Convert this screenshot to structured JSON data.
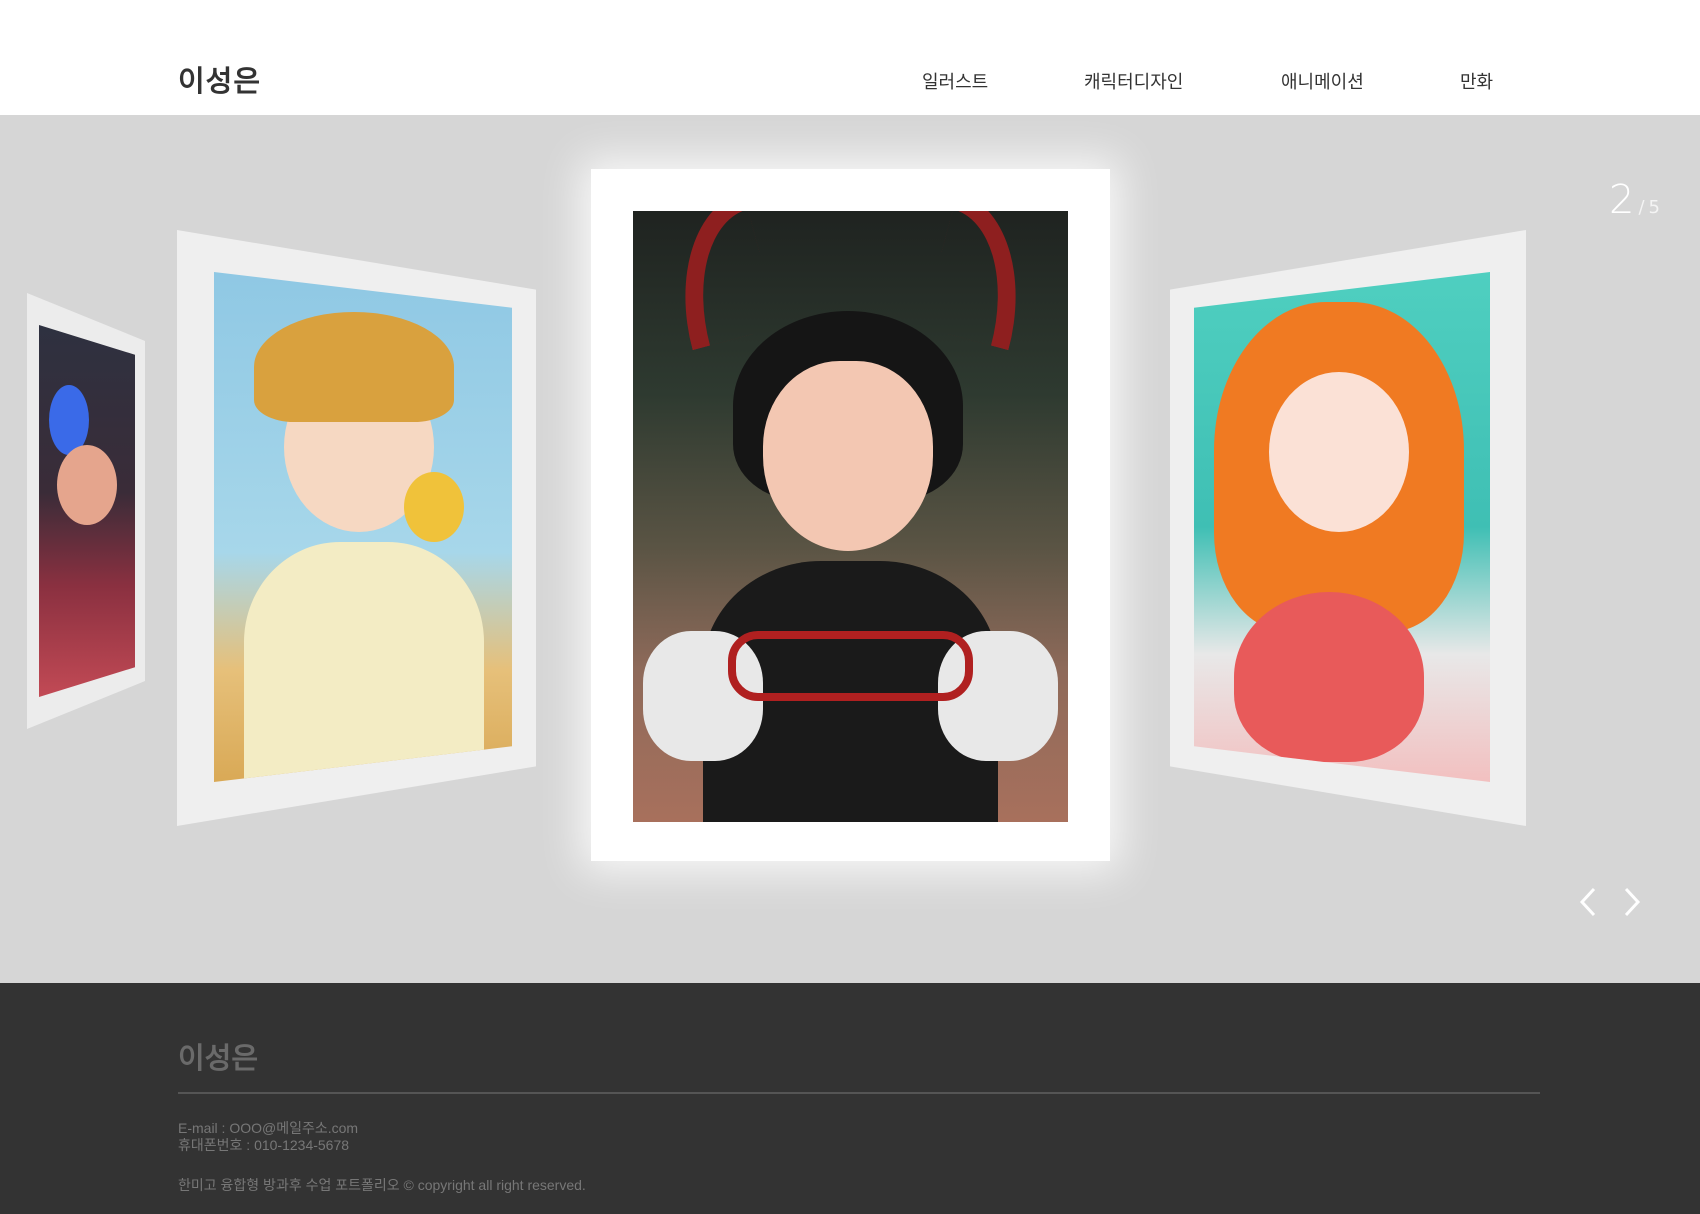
{
  "header": {
    "logo": "이성은",
    "nav": [
      "일러스트",
      "캐릭터디자인",
      "애니메이션",
      "만화"
    ]
  },
  "gallery": {
    "current": "2",
    "separator": "/",
    "total": "5"
  },
  "footer": {
    "logo": "이성은",
    "email": "E-mail : OOO@메일주소.com",
    "phone": "휴대폰번호 : 010-1234-5678",
    "copyright": "한미고 융합형 방과후 수업 포트폴리오 © copyright all right reserved."
  },
  "colors": {
    "stage_bg": "#d6d6d6",
    "footer_bg": "#333333",
    "header_bg": "#ffffff"
  },
  "icons": {
    "prev": "chevron-left-icon",
    "next": "chevron-right-icon"
  }
}
